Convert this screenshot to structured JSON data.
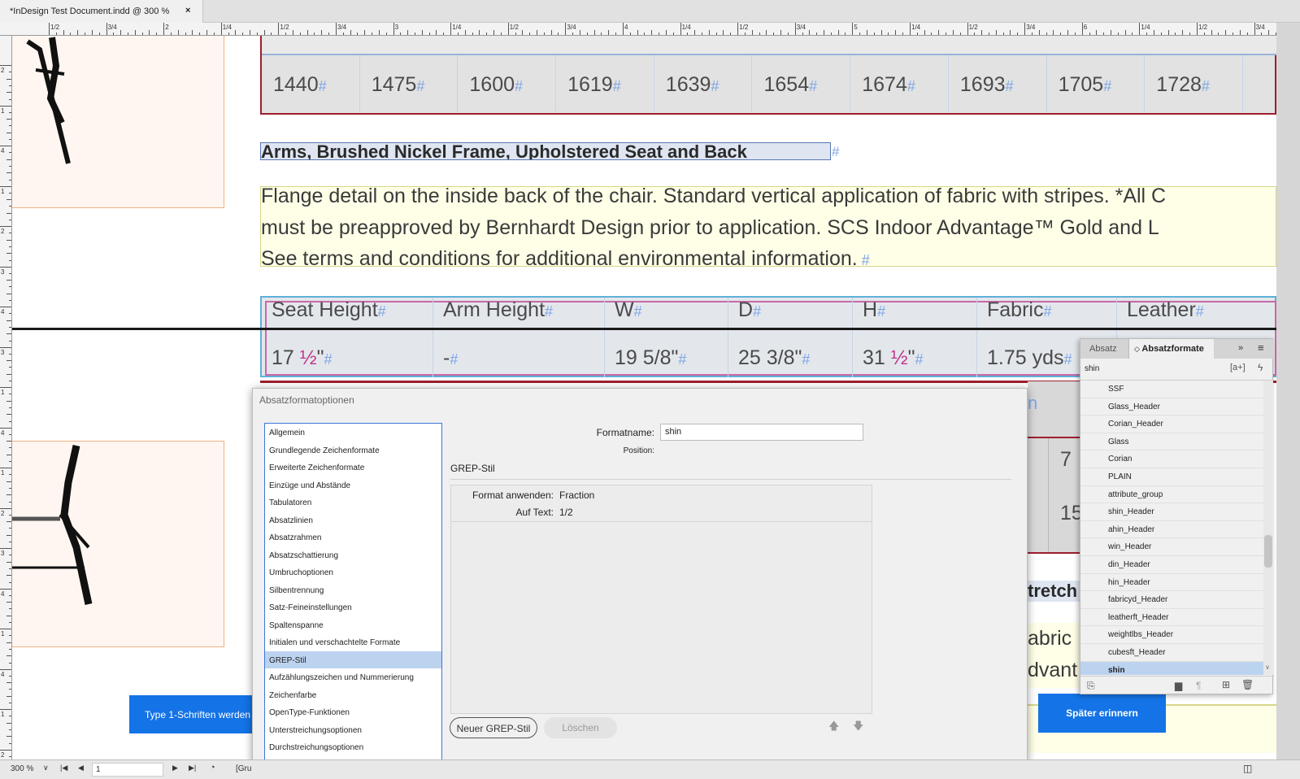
{
  "tab": {
    "title": "*InDesign Test Document.indd @ 300 %",
    "close": "×"
  },
  "ruler": {
    "top_labels": [
      "1/2",
      "3/4",
      "2",
      "1/4",
      "1/2",
      "3/4",
      "3",
      "1/4",
      "1/2",
      "3/4",
      "4",
      "1/4",
      "1/2",
      "3/4",
      "5",
      "1/4",
      "1/2",
      "3/4",
      "6",
      "1/4",
      "1/2",
      "3/4"
    ],
    "left_labels": [
      "2",
      "1",
      "4",
      "1",
      "2",
      "3",
      "4",
      "3",
      "1",
      "4",
      "1",
      "2",
      "3",
      "4",
      "1",
      "4",
      "1",
      "2"
    ]
  },
  "document": {
    "number_row": [
      "1440",
      "1475",
      "1600",
      "1619",
      "1639",
      "1654",
      "1674",
      "1693",
      "1705",
      "1728"
    ],
    "heading": "Arms, Brushed Nickel Frame, Upholstered Seat and Back",
    "paragraph_lines": [
      "Flange detail on the inside back of the chair. Standard vertical application of fabric with stripes. *All C",
      "must be preapproved by Bernhardt Design prior to application. SCS Indoor Advantage™ Gold and L",
      "See terms and conditions for additional environmental information."
    ],
    "pilcrow": "#",
    "spec_headers": [
      "Seat Height",
      "Arm Height",
      "W",
      "D",
      "H",
      "Fabric",
      "Leather"
    ],
    "spec_values": [
      "17 ½\"",
      "-",
      "19 5/8\"",
      "25 3/8\"",
      "31 ½\"",
      "1.75 yds",
      ""
    ],
    "partial_right": [
      "n",
      "7",
      "15",
      "tretch",
      "abric",
      "dvant"
    ]
  },
  "notice": {
    "text": "Type 1-Schriften werden",
    "remind_later": "Später erinnern"
  },
  "dialog": {
    "title": "Absatzformatoptionen",
    "categories": [
      "Allgemein",
      "Grundlegende Zeichenformate",
      "Erweiterte Zeichenformate",
      "Einzüge und Abstände",
      "Tabulatoren",
      "Absatzlinien",
      "Absatzrahmen",
      "Absatzschattierung",
      "Umbruchoptionen",
      "Silbentrennung",
      "Satz-Feineinstellungen",
      "Spaltenspanne",
      "Initialen und verschachtelte Formate",
      "GREP-Stil",
      "Aufzählungszeichen und Nummerierung",
      "Zeichenfarbe",
      "OpenType-Funktionen",
      "Unterstreichungsoptionen",
      "Durchstreichungsoptionen"
    ],
    "selected_index": 13,
    "formatname_label": "Formatname:",
    "formatname_value": "shin",
    "position_label": "Position:",
    "section_title": "GREP-Stil",
    "apply_label": "Format anwenden:",
    "apply_value": "Fraction",
    "text_label": "Auf Text:",
    "text_value": "1/2",
    "new_button": "Neuer GREP-Stil",
    "delete_button": "Löschen"
  },
  "panel": {
    "tab1": "Absatz",
    "tab2": "Absatzformate",
    "search_value": "shin",
    "styles": [
      "SSF",
      "Glass_Header",
      "Corian_Header",
      "Glass",
      "Corian",
      "PLAIN",
      "attribute_group",
      "shin_Header",
      "ahin_Header",
      "win_Header",
      "din_Header",
      "hin_Header",
      "fabricyd_Header",
      "leatherft_Header",
      "weightlbs_Header",
      "cubesft_Header",
      "shin"
    ],
    "selected_style": "shin"
  },
  "status": {
    "zoom": "300 %",
    "page": "1",
    "grid": "[Gru"
  },
  "colors": {
    "accent": "#1473e6",
    "selection": "#bcd3f0",
    "pilcrow": "#7fa6e6"
  }
}
